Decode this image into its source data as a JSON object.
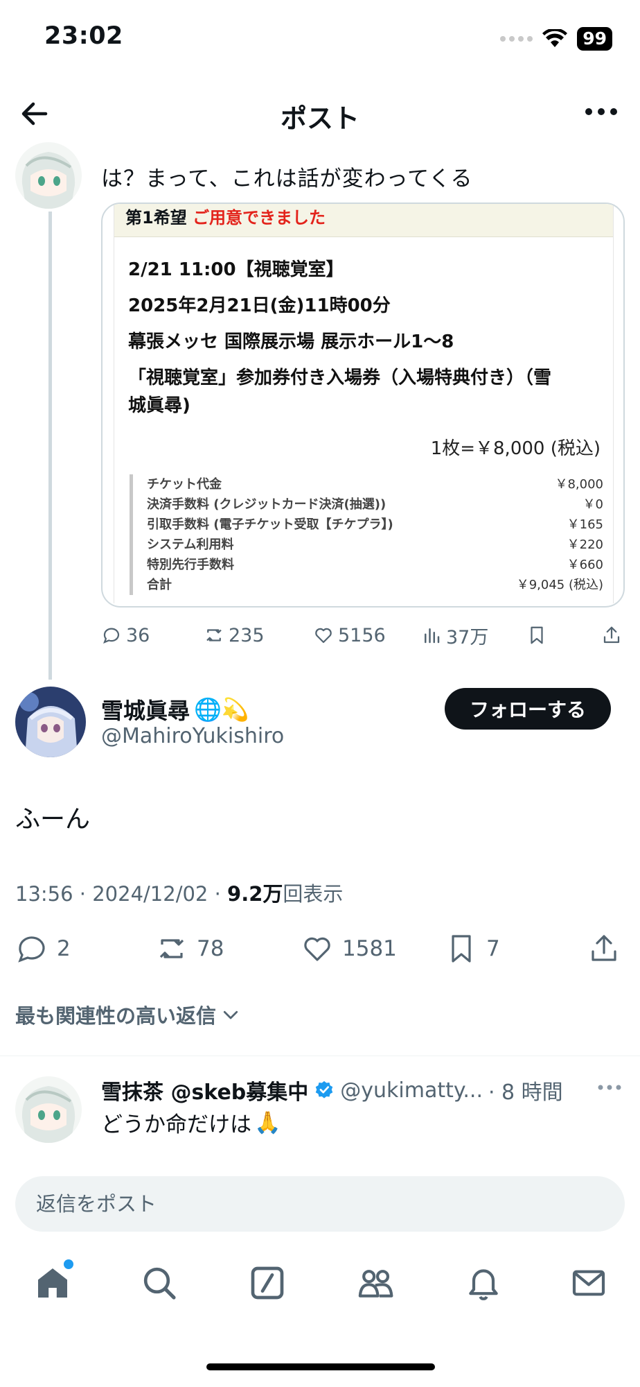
{
  "status_bar": {
    "time": "23:02",
    "battery": "99"
  },
  "header": {
    "title": "ポスト"
  },
  "parent_post": {
    "text": "は？まって、これは話が変わってくる",
    "ticket": {
      "head_prefix": "第1希望",
      "head_status": "ご用意できました",
      "line1": "2/21 11:00【視聴覚室】",
      "line2": "2025年2月21日(金)11時00分",
      "line3": "幕張メッセ 国際展示場 展示ホール1〜8",
      "line4a": "「視聴覚室」参加券付き入場券（入場特典付き）（雪",
      "line4b": "城眞尋)",
      "price": "1枚=￥8,000 (税込)",
      "fees": [
        {
          "label": "チケット代金",
          "value": "￥8,000"
        },
        {
          "label": "決済手数料 (クレジットカード決済(抽選))",
          "value": "￥0"
        },
        {
          "label": "引取手数料 (電子チケット受取【チケプラ】)",
          "value": "￥165"
        },
        {
          "label": "システム利用料",
          "value": "￥220"
        },
        {
          "label": "特別先行手数料",
          "value": "￥660"
        },
        {
          "label": "合計",
          "value": "￥9,045 (税込)"
        }
      ]
    },
    "stats": {
      "replies": "36",
      "reposts": "235",
      "likes": "5156",
      "views": "37万"
    }
  },
  "main_post": {
    "display_name": "雪城眞尋",
    "name_emoji": "🌐💫",
    "handle": "@MahiroYukishiro",
    "follow_label": "フォローする",
    "text": "ふーん",
    "time": "13:56 · 2024/12/02 · ",
    "views_value": "9.2万",
    "views_suffix": "回表示",
    "replies": "2",
    "reposts": "78",
    "likes": "1581",
    "bookmarks": "7"
  },
  "sort_label": "最も関連性の高い返信",
  "reply": {
    "display_name": "雪抹茶 @skeb募集中",
    "handle": "@yukimatty...",
    "time": "· 8 時間",
    "text": "どうか命だけは",
    "emoji": "🙏"
  },
  "reply_bar": {
    "placeholder": "返信をポスト"
  },
  "colors": {
    "accent": "#1d9bf0",
    "text": "#0f1419",
    "secondary": "#536471",
    "alert_red": "#e3231b"
  }
}
